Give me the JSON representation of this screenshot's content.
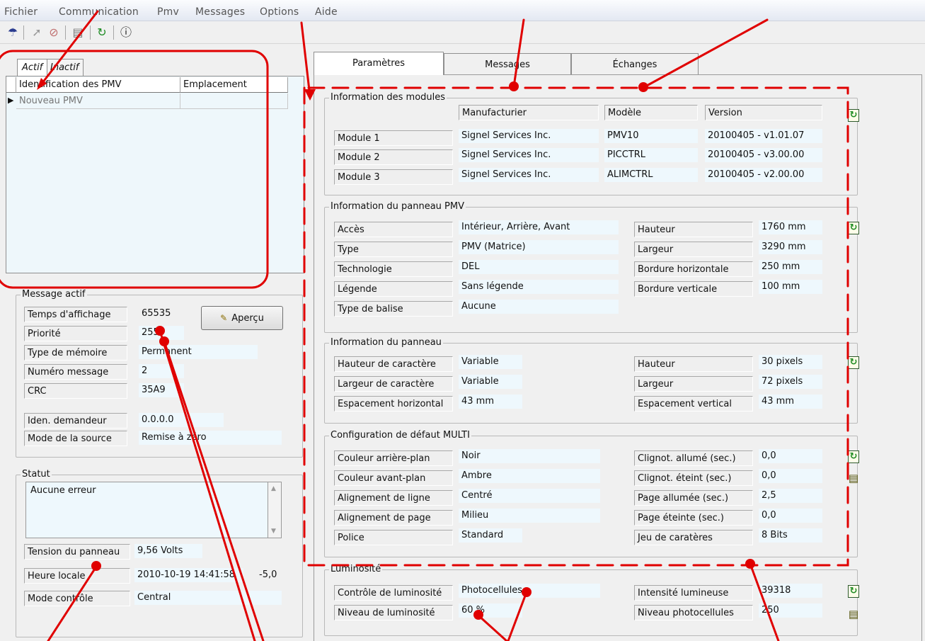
{
  "menu": [
    "Fichier",
    "Communication",
    "Pmv",
    "Messages",
    "Options",
    "Aide"
  ],
  "toolbar": [
    "exit-icon",
    "connect-icon",
    "disconnect-icon",
    "print-icon",
    "refresh-icon",
    "info-icon"
  ],
  "left_tabs": {
    "active": "Actif",
    "inactive": "Inactif"
  },
  "pmv_table": {
    "columns": [
      "Identification des PMV",
      "Emplacement"
    ],
    "rows": [
      {
        "id": "Nouveau PMV",
        "location": ""
      }
    ]
  },
  "message_actif": {
    "title": "Message actif",
    "rows": [
      {
        "label": "Temps d'affichage",
        "value": "65535"
      },
      {
        "label": "Priorité",
        "value": "255"
      },
      {
        "label": "Type de mémoire",
        "value": "Permanent"
      },
      {
        "label": "Numéro message",
        "value": "2"
      },
      {
        "label": "CRC",
        "value": "35A9"
      },
      {
        "label": "Iden. demandeur",
        "value": "0.0.0.0"
      },
      {
        "label": "Mode de la source",
        "value": "Remise à zéro"
      }
    ],
    "preview_button": "Aperçu"
  },
  "statut": {
    "title": "Statut",
    "text": "Aucune erreur",
    "rows": [
      {
        "label": "Tension du panneau",
        "value": "9,56 Volts"
      },
      {
        "label": "Heure locale",
        "value": "2010-10-19 14:41:58",
        "extra": "-5,0"
      },
      {
        "label": "Mode contrôle",
        "value": "Central"
      }
    ]
  },
  "right_tabs": [
    "Paramètres",
    "Messages",
    "Échanges"
  ],
  "modules": {
    "title": "Information des modules",
    "headers": [
      "Manufacturier",
      "Modèle",
      "Version"
    ],
    "rows": [
      {
        "label": "Module 1",
        "manufacturer": "Signel Services Inc.",
        "model": "PMV10",
        "version": "20100405 - v1.01.07"
      },
      {
        "label": "Module 2",
        "manufacturer": "Signel Services Inc.",
        "model": "PICCTRL",
        "version": "20100405 - v3.00.00"
      },
      {
        "label": "Module 3",
        "manufacturer": "Signel Services Inc.",
        "model": "ALIMCTRL",
        "version": "20100405 - v2.00.00"
      }
    ]
  },
  "panneau_pmv": {
    "title": "Information du panneau PMV",
    "left": [
      {
        "label": "Accès",
        "value": "Intérieur, Arrière, Avant"
      },
      {
        "label": "Type",
        "value": "PMV (Matrice)"
      },
      {
        "label": "Technologie",
        "value": "DEL"
      },
      {
        "label": "Légende",
        "value": "Sans légende"
      },
      {
        "label": "Type de balise",
        "value": "Aucune"
      }
    ],
    "right": [
      {
        "label": "Hauteur",
        "value": "1760 mm"
      },
      {
        "label": "Largeur",
        "value": "3290 mm"
      },
      {
        "label": "Bordure horizontale",
        "value": "250 mm"
      },
      {
        "label": "Bordure verticale",
        "value": "100 mm"
      }
    ]
  },
  "panneau": {
    "title": "Information du panneau",
    "left": [
      {
        "label": "Hauteur de caractère",
        "value": "Variable"
      },
      {
        "label": "Largeur de caractère",
        "value": "Variable"
      },
      {
        "label": "Espacement horizontal",
        "value": "43 mm"
      }
    ],
    "right": [
      {
        "label": "Hauteur",
        "value": "30 pixels"
      },
      {
        "label": "Largeur",
        "value": "72 pixels"
      },
      {
        "label": "Espacement vertical",
        "value": "43 mm"
      }
    ]
  },
  "multi": {
    "title": "Configuration de défaut MULTI",
    "left": [
      {
        "label": "Couleur arrière-plan",
        "value": "Noir"
      },
      {
        "label": "Couleur avant-plan",
        "value": "Ambre"
      },
      {
        "label": "Alignement de ligne",
        "value": "Centré"
      },
      {
        "label": "Alignement de page",
        "value": "Milieu"
      },
      {
        "label": "Police",
        "value": "Standard"
      }
    ],
    "right": [
      {
        "label": "Clignot. allumé (sec.)",
        "value": "0,0"
      },
      {
        "label": "Clignot. éteint (sec.)",
        "value": "0,0"
      },
      {
        "label": "Page allumée (sec.)",
        "value": "2,5"
      },
      {
        "label": "Page éteinte (sec.)",
        "value": "0,0"
      },
      {
        "label": "Jeu de caratères",
        "value": "8 Bits"
      }
    ]
  },
  "luminosite": {
    "title": "Luminosité",
    "left": [
      {
        "label": "Contrôle de luminosité",
        "value": "Photocellules"
      },
      {
        "label": "Niveau de luminosité",
        "value": "60 %"
      }
    ],
    "right": [
      {
        "label": "Intensité lumineuse",
        "value": "39318"
      },
      {
        "label": "Niveau photocellules",
        "value": "250"
      }
    ]
  },
  "colors": {
    "annotation": "#e00000",
    "field_bg": "#eef8fd",
    "window_bg": "#f0f0f0"
  }
}
